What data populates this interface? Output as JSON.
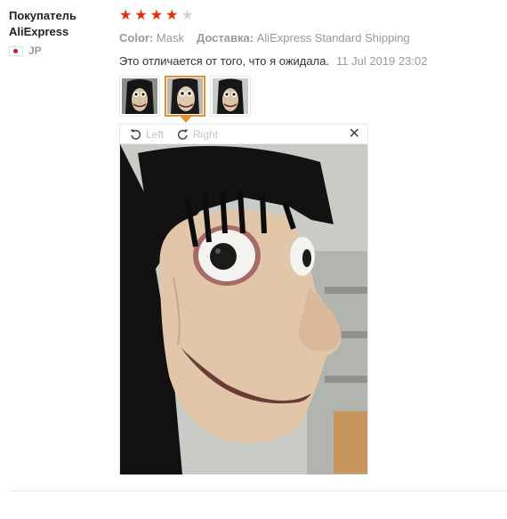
{
  "user": {
    "name_line1": "Покупатель",
    "name_line2": "AliExpress",
    "country_code": "JP",
    "flag_icon": "japan-flag-icon"
  },
  "review": {
    "rating": 4,
    "rating_max": 5,
    "color_label": "Color:",
    "color_value": "Mask",
    "shipping_label": "Доставка:",
    "shipping_value": "AliExpress Standard Shipping",
    "text": "Это отличается от того, что я ожидала.",
    "date": "11 Jul 2019 23:02"
  },
  "thumbnails": {
    "count": 3,
    "active_index": 1
  },
  "viewer": {
    "rotate_left_label": "Left",
    "rotate_right_label": "Right",
    "close_glyph": "✕"
  },
  "colors": {
    "star_active": "#e62e04",
    "star_inactive": "#d5d5d5",
    "thumb_active_border": "#e98c2f",
    "muted_text": "#999999"
  }
}
